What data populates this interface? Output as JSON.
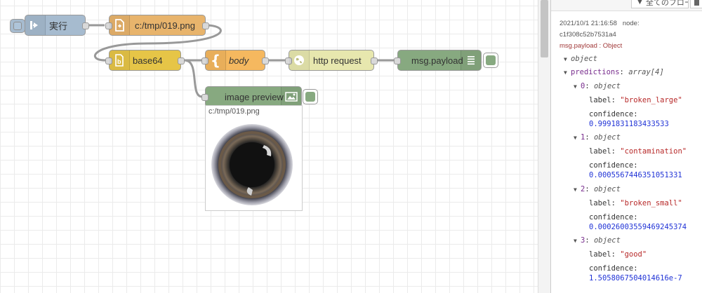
{
  "flow": {
    "nodes": {
      "inject": {
        "label": "実行",
        "color": "#a6bbcf"
      },
      "file_in": {
        "label": "c:/tmp/019.png",
        "color": "#e8b46c"
      },
      "base64": {
        "label": "base64",
        "color": "#e6c547"
      },
      "change": {
        "label": "body",
        "color": "#f5b85f"
      },
      "http": {
        "label": "http request",
        "color": "#e7e7ae"
      },
      "debug": {
        "label": "msg.payload",
        "color": "#87a980"
      },
      "preview": {
        "label": "image preview",
        "color": "#87a980"
      }
    },
    "preview_caption": "c:/tmp/019.png"
  },
  "sidebar": {
    "filter_label": "全てのフロー",
    "timestamp": "2021/10/1 21:16:58",
    "node_label": "node:",
    "node_id": "c1f308c52b7531a4",
    "topic": "msg.payload : Object",
    "tree": {
      "root_type": "object",
      "predictions_key": "predictions",
      "predictions_type": "array[4]",
      "items": [
        {
          "index": "0",
          "type": "object",
          "label": "\"broken_large\"",
          "confidence": "0.9991831183433533"
        },
        {
          "index": "1",
          "type": "object",
          "label": "\"contamination\"",
          "confidence": "0.0005567446351051331"
        },
        {
          "index": "2",
          "type": "object",
          "label": "\"broken_small\"",
          "confidence": "0.00026003559469245374"
        },
        {
          "index": "3",
          "type": "object",
          "label": "\"good\"",
          "confidence": "1.5058067504014616e-7"
        }
      ]
    }
  }
}
